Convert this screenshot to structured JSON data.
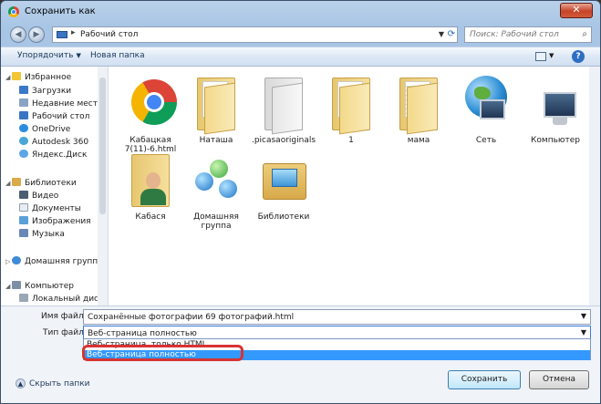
{
  "window": {
    "title": "Сохранить как",
    "close_label": "✕"
  },
  "nav": {
    "back_glyph": "◀",
    "forward_glyph": "▶",
    "address_separator": "▸",
    "address": "Рабочий стол",
    "search_placeholder": "Поиск: Рабочий стол"
  },
  "toolbar": {
    "organize": "Упорядочить",
    "new_folder": "Новая папка"
  },
  "sidebar": {
    "favorites": "Избранное",
    "favorites_items": [
      "Загрузки",
      "Недавние места",
      "Рабочий стол",
      "OneDrive",
      "Autodesk 360",
      "Яндекс.Диск"
    ],
    "libraries": "Библиотеки",
    "libraries_items": [
      "Видео",
      "Документы",
      "Изображения",
      "Музыка"
    ],
    "homegroup": "Домашняя группа",
    "computer": "Компьютер",
    "computer_items": [
      "Локальный диск"
    ]
  },
  "files": [
    {
      "name": "Кабацкая 7(11)-6.html",
      "icon": "chrome-icon"
    },
    {
      "name": "Наташа",
      "icon": "folder-icon"
    },
    {
      "name": ".picasaoriginals",
      "icon": "folder-icon"
    },
    {
      "name": "1",
      "icon": "folder-icon"
    },
    {
      "name": "мама",
      "icon": "folder-icon"
    },
    {
      "name": "Сеть",
      "icon": "network-icon"
    },
    {
      "name": "Компьютер",
      "icon": "computer-icon"
    },
    {
      "name": "Кабася",
      "icon": "user-folder-icon"
    },
    {
      "name": "Домашняя группа",
      "icon": "homegroup-icon"
    },
    {
      "name": "Библиотеки",
      "icon": "libraries-icon"
    }
  ],
  "form": {
    "filename_label": "Имя файла:",
    "filename_value": "Сохранённые фотографии 69 фотографий.html",
    "filetype_label": "Тип файла:",
    "filetype_value": "Веб-страница полностью",
    "options": [
      "Веб-страница, только HTML",
      "Веб-страница полностью"
    ]
  },
  "footer": {
    "hide_folders": "Скрыть папки",
    "save": "Сохранить",
    "cancel": "Отмена"
  },
  "colors": {
    "accent": "#3399ff",
    "highlight_mark": "#d93232"
  }
}
